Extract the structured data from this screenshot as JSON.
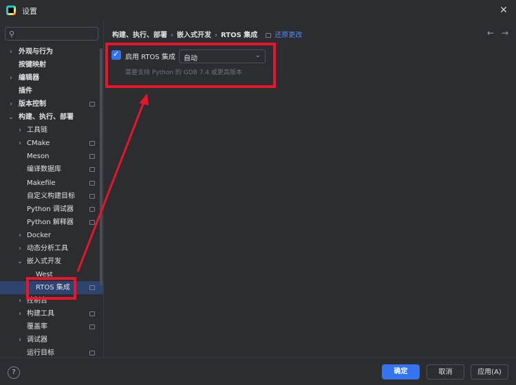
{
  "window": {
    "title": "设置",
    "close_glyph": "✕"
  },
  "search": {
    "placeholder": ""
  },
  "tree": [
    {
      "label": "外观与行为",
      "indent": 0,
      "arrow": "›",
      "bold": true,
      "badge": false
    },
    {
      "label": "按键映射",
      "indent": 0,
      "arrow": "",
      "bold": true,
      "badge": false
    },
    {
      "label": "编辑器",
      "indent": 0,
      "arrow": "›",
      "bold": true,
      "badge": false
    },
    {
      "label": "插件",
      "indent": 0,
      "arrow": "",
      "bold": true,
      "badge": false
    },
    {
      "label": "版本控制",
      "indent": 0,
      "arrow": "›",
      "bold": true,
      "badge": true
    },
    {
      "label": "构建、执行、部署",
      "indent": 0,
      "arrow": "⌄",
      "bold": true,
      "badge": false
    },
    {
      "label": "工具链",
      "indent": 1,
      "arrow": "›",
      "bold": false,
      "badge": false
    },
    {
      "label": "CMake",
      "indent": 1,
      "arrow": "›",
      "bold": false,
      "badge": true
    },
    {
      "label": "Meson",
      "indent": 1,
      "arrow": "",
      "bold": false,
      "badge": true
    },
    {
      "label": "编译数据库",
      "indent": 1,
      "arrow": "",
      "bold": false,
      "badge": true
    },
    {
      "label": "Makefile",
      "indent": 1,
      "arrow": "",
      "bold": false,
      "badge": true
    },
    {
      "label": "自定义构建目标",
      "indent": 1,
      "arrow": "",
      "bold": false,
      "badge": true
    },
    {
      "label": "Python 调试器",
      "indent": 1,
      "arrow": "",
      "bold": false,
      "badge": true
    },
    {
      "label": "Python 解释器",
      "indent": 1,
      "arrow": "",
      "bold": false,
      "badge": true
    },
    {
      "label": "Docker",
      "indent": 1,
      "arrow": "›",
      "bold": false,
      "badge": false
    },
    {
      "label": "动态分析工具",
      "indent": 1,
      "arrow": "›",
      "bold": false,
      "badge": false
    },
    {
      "label": "嵌入式开发",
      "indent": 1,
      "arrow": "⌄",
      "bold": false,
      "badge": false
    },
    {
      "label": "West",
      "indent": 2,
      "arrow": "",
      "bold": false,
      "badge": false
    },
    {
      "label": "RTOS 集成",
      "indent": 2,
      "arrow": "",
      "bold": false,
      "badge": true,
      "selected": true
    },
    {
      "label": "控制台",
      "indent": 1,
      "arrow": "›",
      "bold": false,
      "badge": false
    },
    {
      "label": "构建工具",
      "indent": 1,
      "arrow": "›",
      "bold": false,
      "badge": true
    },
    {
      "label": "覆盖率",
      "indent": 1,
      "arrow": "",
      "bold": false,
      "badge": true
    },
    {
      "label": "调试器",
      "indent": 1,
      "arrow": "›",
      "bold": false,
      "badge": false
    },
    {
      "label": "运行目标",
      "indent": 1,
      "arrow": "",
      "bold": false,
      "badge": true
    }
  ],
  "breadcrumb": {
    "parts": [
      "构建、执行、部署",
      "嵌入式开发",
      "RTOS 集成"
    ],
    "separator": "›",
    "reset_label": "还原更改"
  },
  "nav": {
    "back": "←",
    "forward": "→"
  },
  "settings": {
    "enable_rtos_label": "启用 RTOS 集成",
    "enable_rtos_checked": true,
    "mode_value": "自动",
    "hint": "需要支持 Python 的 GDB 7.4 或更高版本"
  },
  "footer": {
    "help": "?",
    "ok": "确定",
    "cancel": "取消",
    "apply": "应用(A)"
  },
  "colors": {
    "accent": "#3574f0",
    "selected_row": "#2e436e",
    "annotation": "#e8162a",
    "link": "#548af7"
  },
  "icons": {
    "search": "search-icon",
    "checkmark": "checkmark-icon",
    "chevron": "chevron-down-icon",
    "close": "close-icon",
    "help": "help-icon"
  }
}
